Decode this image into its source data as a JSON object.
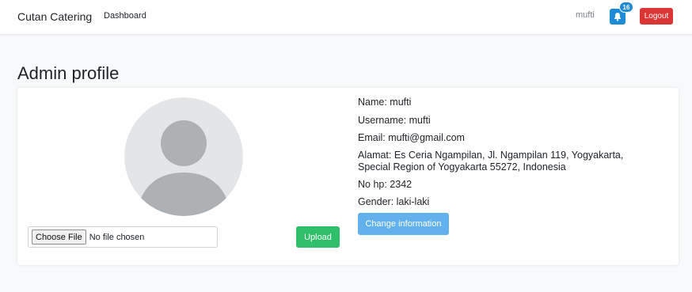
{
  "navbar": {
    "brand": "Cutan Catering",
    "dashboard_link": "Dashboard",
    "username": "mufti",
    "notification_count": "16",
    "logout_label": "Logout"
  },
  "page": {
    "title": "Admin profile"
  },
  "upload": {
    "choose_file_label": "Choose File",
    "no_file_text": "No file chosen",
    "upload_label": "Upload"
  },
  "profile": {
    "name": "Name: mufti",
    "username": "Username: mufti",
    "email": "Email: mufti@gmail.com",
    "address_line1": "Alamat: Es Ceria Ngampilan, Jl. Ngampilan 119, Yogyakarta,",
    "address_line2": "Special Region of Yogyakarta 55272, Indonesia",
    "phone": "No hp: 2342",
    "gender": "Gender: laki-laki",
    "change_label": "Change information"
  },
  "colors": {
    "primary": "#1d8bd6",
    "danger": "#dc3535",
    "success": "#2fbf6a",
    "info": "#62b1ec"
  },
  "icons": {
    "notification": "bell-icon",
    "avatar": "user-placeholder-icon"
  }
}
